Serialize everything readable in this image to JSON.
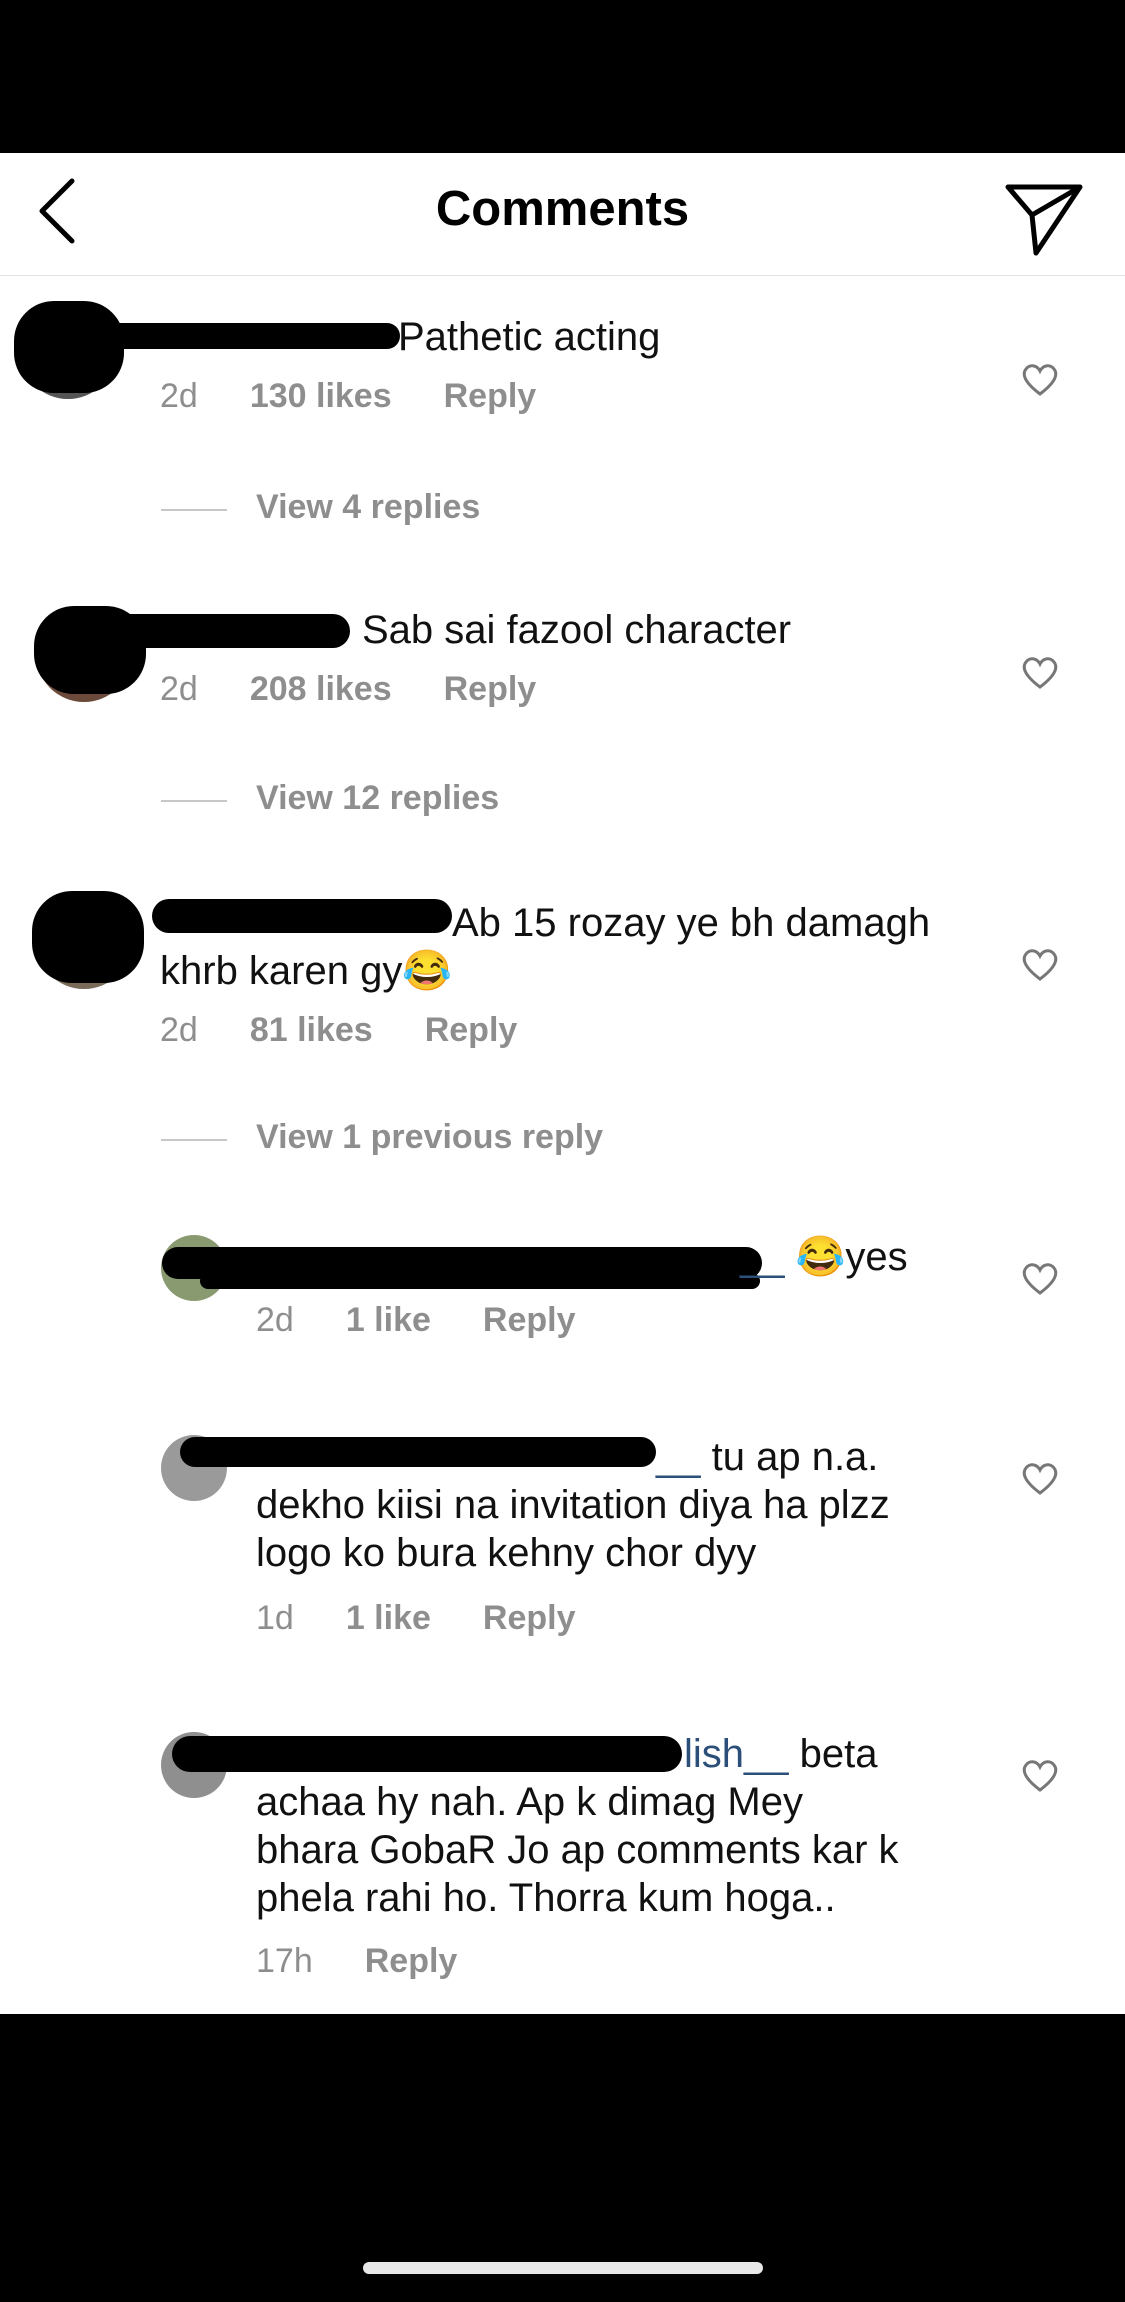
{
  "header": {
    "title": "Comments"
  },
  "comments": [
    {
      "text": "Pathetic acting",
      "time": "2d",
      "likes": "130 likes",
      "reply": "Reply",
      "view_replies": "View 4 replies"
    },
    {
      "text": "Sab sai fazool character",
      "time": "2d",
      "likes": "208 likes",
      "reply": "Reply",
      "view_replies": "View 12 replies"
    },
    {
      "text_line1": "Ab 15 rozay ye bh damagh",
      "text_line2": "khrb karen gy😂",
      "time": "2d",
      "likes": "81 likes",
      "reply": "Reply",
      "view_replies": "View 1 previous reply"
    }
  ],
  "replies": [
    {
      "mention": "__",
      "text": " 😂yes",
      "time": "2d",
      "likes": "1 like",
      "reply": "Reply"
    },
    {
      "mention": "__",
      "text_line1": " tu ap n.a.",
      "text_line2": "dekho kiisi na invitation diya ha plzz",
      "text_line3": "logo ko bura kehny chor dyy",
      "time": "1d",
      "likes": "1 like",
      "reply": "Reply"
    },
    {
      "mention": "lish__",
      "text_line1": " beta",
      "text_line2": "achaa hy nah. Ap k dimag Mey",
      "text_line3": "bhara GobaR Jo ap comments kar k",
      "text_line4": "phela rahi ho. Thorra kum hoga..",
      "time": "17h",
      "reply": "Reply"
    }
  ],
  "icons": {
    "back": "chevron-left-icon",
    "send": "paper-plane-icon",
    "like": "heart-outline-icon"
  }
}
